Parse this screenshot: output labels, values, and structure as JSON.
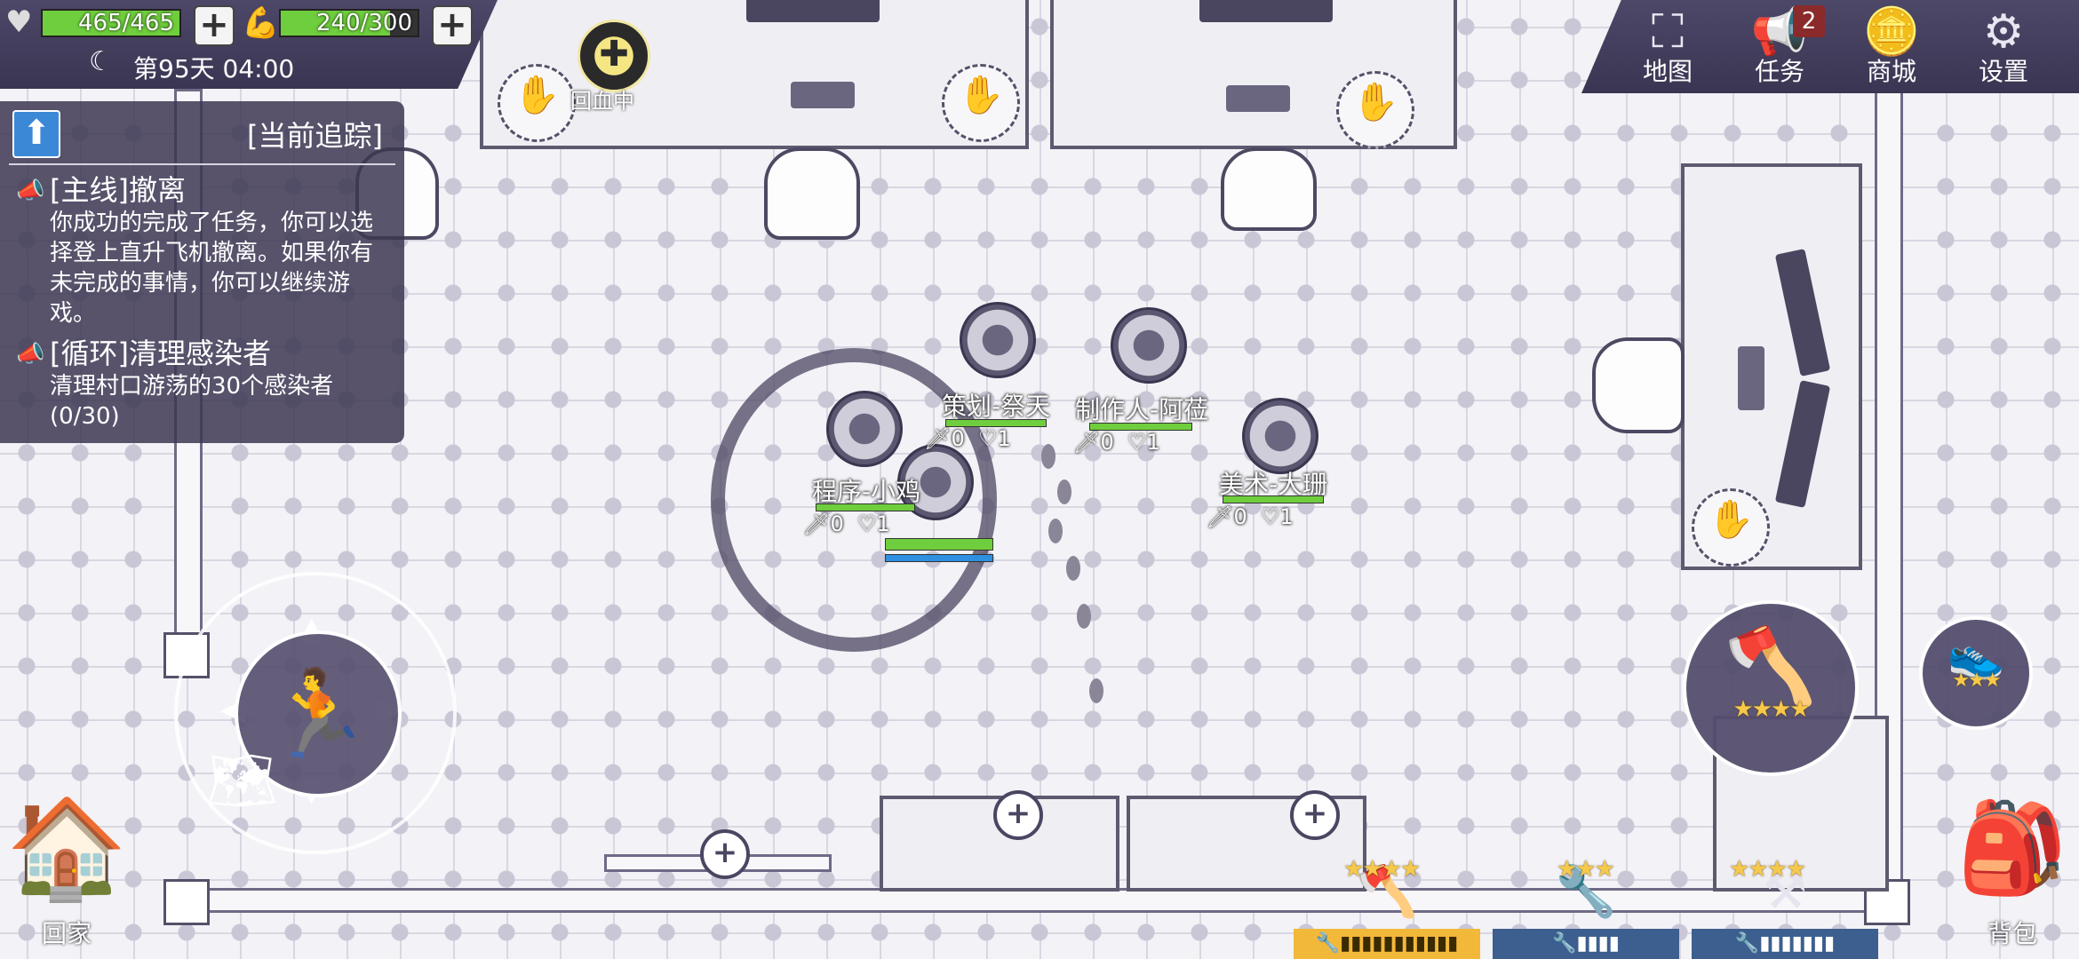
{
  "status": {
    "health": "465/465",
    "health_fraction": 1.0,
    "stamina": "240/300",
    "stamina_fraction": 0.8,
    "day_time": "第95天 04:00"
  },
  "healing": {
    "label": "回血中"
  },
  "menu": {
    "map": "地图",
    "tasks": "任务",
    "tasks_badge": "2",
    "shop": "商城",
    "settings": "设置"
  },
  "quest": {
    "header": "[当前追踪]",
    "items": [
      {
        "title": "[主线]撤离",
        "desc": "你成功的完成了任务，你可以选择登上直升飞机撤离。如果你有未完成的事情，你可以继续游戏。"
      },
      {
        "title": "[循环]清理感染者",
        "desc": "清理村口游荡的30个感染者",
        "progress": "(0/30)"
      }
    ]
  },
  "characters": [
    {
      "name": "程序-小鸡",
      "attack": "0",
      "life": "1"
    },
    {
      "name": "策划-祭天",
      "attack": "0",
      "life": "1"
    },
    {
      "name": "制作人-阿莅",
      "attack": "0",
      "life": "1"
    },
    {
      "name": "美术-大珊",
      "attack": "0",
      "life": "1"
    }
  ],
  "weapon": {
    "stars": "★★★★"
  },
  "skill": {
    "stars": "★★★"
  },
  "bottom": {
    "home": "回家",
    "bag": "背包",
    "slots": [
      {
        "stars": "★★★★",
        "durability": "🔧▮▮▮▮▮▮▮▮▮▮▮"
      },
      {
        "stars": "★★★",
        "durability": "🔧▮▮▮▮"
      },
      {
        "stars": "★★★★",
        "durability": "🔧▮▮▮▮▮▮▮"
      }
    ]
  },
  "colors": {
    "hud_bg": "#4d4868",
    "hp_green": "#6fce3d",
    "mp_blue": "#2f8fe0",
    "star_gold": "#f6c94a",
    "badge_red": "#8a2a2a"
  }
}
